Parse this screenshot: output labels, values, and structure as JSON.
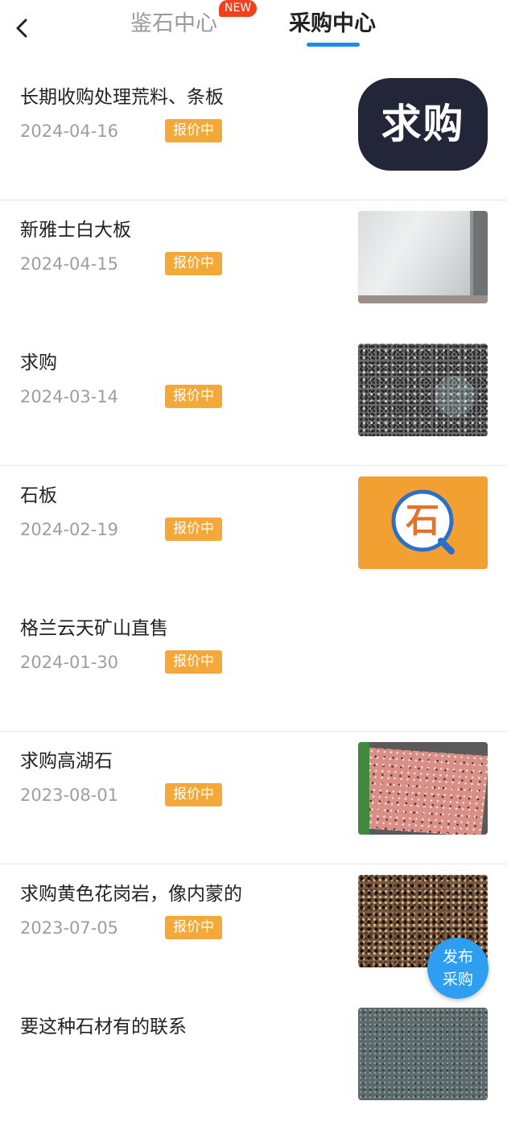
{
  "header": {
    "tabs": [
      {
        "label": "鉴石中心",
        "badge": "NEW"
      },
      {
        "label": "采购中心"
      }
    ],
    "active_tab": "采购中心"
  },
  "items": [
    {
      "title": "长期收购处理荒料、条板",
      "date": "2024-04-16",
      "status": "报价中",
      "thumb_text": "求购",
      "thumb": "qiugou-sign"
    },
    {
      "title": "新雅士白大板",
      "date": "2024-04-15",
      "status": "报价中",
      "thumb": "white-marble-slab"
    },
    {
      "title": "求购",
      "date": "2024-03-14",
      "status": "报价中",
      "thumb": "speckled-granite"
    },
    {
      "title": "石板",
      "date": "2024-02-19",
      "status": "报价中",
      "thumb_text": "石",
      "thumb": "stone-logo-icon"
    },
    {
      "title": "格兰云天矿山直售",
      "date": "2024-01-30",
      "status": "报价中",
      "thumb": "none"
    },
    {
      "title": "求购高湖石",
      "date": "2023-08-01",
      "status": "报价中",
      "thumb": "pink-granite-tile"
    },
    {
      "title": "求购黄色花岗岩，像内蒙的",
      "date": "2023-07-05",
      "status": "报价中",
      "thumb": "yellow-granite"
    },
    {
      "title": "要这种石材有的联系",
      "date": "",
      "status": "",
      "thumb": "grey-stone"
    }
  ],
  "fab": {
    "line1": "发布",
    "line2": "采购"
  },
  "colors": {
    "accent": "#1a8df0",
    "status": "#f3a839",
    "badge": "#f2401f",
    "fab": "#2e9ef0"
  }
}
